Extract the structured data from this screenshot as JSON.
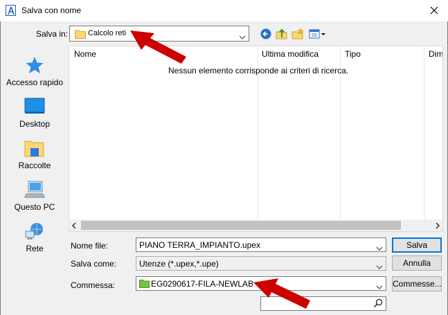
{
  "window": {
    "title": "Salva con nome"
  },
  "location": {
    "label": "Salva in:",
    "value": "Calcolo reti"
  },
  "toolbar": {
    "icons": [
      "back-icon",
      "up-folder-icon",
      "new-folder-icon",
      "view-menu-icon"
    ]
  },
  "places": [
    {
      "label": "Accesso rapido",
      "icon": "star-icon"
    },
    {
      "label": "Desktop",
      "icon": "desktop-icon"
    },
    {
      "label": "Raccolte",
      "icon": "libraries-icon"
    },
    {
      "label": "Questo PC",
      "icon": "computer-icon"
    },
    {
      "label": "Rete",
      "icon": "network-icon"
    }
  ],
  "file_list": {
    "columns": [
      "Nome",
      "Ultima modifica",
      "Tipo",
      "Dim"
    ],
    "empty_message": "Nessun elemento corrisponde ai criteri di ricerca."
  },
  "form": {
    "filename_label": "Nome file:",
    "filename_value": "PIANO TERRA_IMPIANTO.upex",
    "savetype_label": "Salva come:",
    "savetype_value": "Utenze (*.upex,*.upe)",
    "commessa_label": "Commessa:",
    "commessa_value": "EG0290617-FILA-NEWLAB",
    "search_value": ""
  },
  "buttons": {
    "save": "Salva",
    "cancel": "Annulla",
    "commesse": "Commesse..."
  },
  "colors": {
    "accent": "#0078d7",
    "annotation_arrow": "#cc0000",
    "folder_yellow": "#f8d775",
    "folder_green": "#7cc242"
  }
}
